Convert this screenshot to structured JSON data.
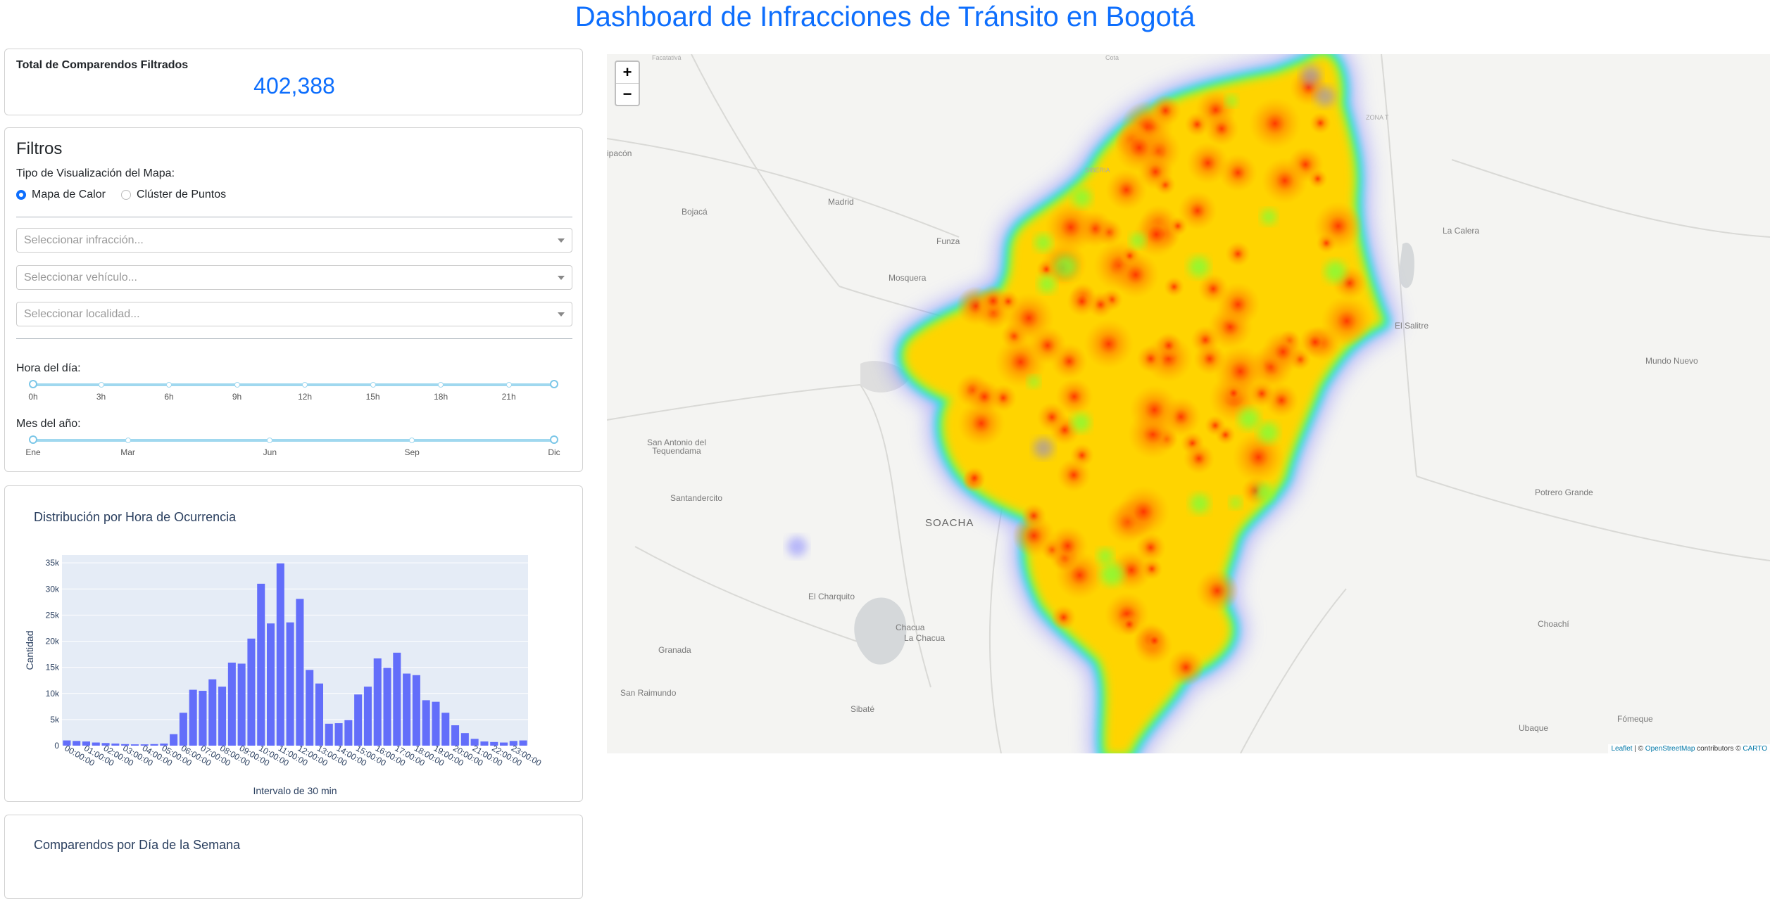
{
  "header": {
    "title": "Dashboard de Infracciones de Tránsito en Bogotá"
  },
  "total": {
    "label": "Total de Comparendos Filtrados",
    "value": "402,388"
  },
  "filters": {
    "title": "Filtros",
    "map_type_label": "Tipo de Visualización del Mapa:",
    "radio_options": [
      {
        "label": "Mapa de Calor",
        "checked": true
      },
      {
        "label": "Clúster de Puntos",
        "checked": false
      }
    ],
    "dropdowns": [
      {
        "placeholder": "Seleccionar infracción..."
      },
      {
        "placeholder": "Seleccionar vehículo..."
      },
      {
        "placeholder": "Seleccionar localidad..."
      }
    ],
    "hour_slider": {
      "label": "Hora del día:",
      "marks": [
        "0h",
        "3h",
        "6h",
        "9h",
        "12h",
        "15h",
        "18h",
        "21h"
      ],
      "min": 0,
      "max": 23,
      "range": [
        0,
        23
      ]
    },
    "month_slider": {
      "label": "Mes del año:",
      "marks": [
        "Ene",
        "Mar",
        "Jun",
        "Sep",
        "Dic"
      ],
      "min": 1,
      "max": 12,
      "range": [
        1,
        12
      ]
    }
  },
  "weekday_chart": {
    "title": "Comparendos por Día de la Semana"
  },
  "map": {
    "zoom_in": "+",
    "zoom_out": "−",
    "attribution": {
      "leaflet": "Leaflet",
      "sep": " | © ",
      "osm": "OpenStreetMap",
      "contrib": " contributors © ",
      "carto": "CARTO"
    },
    "places": [
      {
        "name": "Madrid",
        "class": ""
      },
      {
        "name": "Funza",
        "class": ""
      },
      {
        "name": "Mosquera",
        "class": ""
      },
      {
        "name": "Bojacá",
        "class": ""
      },
      {
        "name": "La Calera",
        "class": ""
      },
      {
        "name": "El Salitre",
        "class": ""
      },
      {
        "name": "Mundo Nuevo",
        "class": ""
      },
      {
        "name": "San Antonio del Tequendama",
        "class": ""
      },
      {
        "name": "Santandercito",
        "class": ""
      },
      {
        "name": "SOACHA",
        "class": "big"
      },
      {
        "name": "El Charquito",
        "class": ""
      },
      {
        "name": "Chacua",
        "class": ""
      },
      {
        "name": "La Chacua",
        "class": ""
      },
      {
        "name": "Granada",
        "class": ""
      },
      {
        "name": "San Raimundo",
        "class": ""
      },
      {
        "name": "Sibaté",
        "class": ""
      },
      {
        "name": "Potrero Grande",
        "class": ""
      },
      {
        "name": "Choachí",
        "class": ""
      },
      {
        "name": "Ubaque",
        "class": ""
      },
      {
        "name": "Fómeque",
        "class": ""
      },
      {
        "name": "ipacón",
        "class": ""
      },
      {
        "name": "SIBERIA",
        "class": "small"
      },
      {
        "name": "ZONA T",
        "class": "small"
      },
      {
        "name": "Facatativá",
        "class": "small"
      },
      {
        "name": "Cota",
        "class": "small"
      }
    ]
  },
  "colors": {
    "accent": "#0d6efd",
    "bar": "#636efa",
    "plot_bg": "#e5ecf6"
  },
  "chart_data": {
    "type": "bar",
    "title": "Distribución por Hora de Ocurrencia",
    "xlabel": "Intervalo de 30 min",
    "ylabel": "Cantidad",
    "ylim": [
      0,
      36500
    ],
    "ytick_values": [
      0,
      5000,
      10000,
      15000,
      20000,
      25000,
      30000,
      35000
    ],
    "ytick_labels": [
      "0",
      "5k",
      "10k",
      "15k",
      "20k",
      "25k",
      "30k",
      "35k"
    ],
    "xtick_labels": [
      "00:00:00",
      "01:00:00",
      "02:00:00",
      "03:00:00",
      "04:00:00",
      "05:00:00",
      "06:00:00",
      "07:00:00",
      "08:00:00",
      "09:00:00",
      "10:00:00",
      "11:00:00",
      "12:00:00",
      "13:00:00",
      "14:00:00",
      "15:00:00",
      "16:00:00",
      "17:00:00",
      "18:00:00",
      "19:00:00",
      "20:00:00",
      "21:00:00",
      "22:00:00",
      "23:00:00"
    ],
    "values": [
      1000,
      900,
      800,
      600,
      500,
      400,
      300,
      250,
      250,
      300,
      400,
      2200,
      6300,
      10700,
      10500,
      12700,
      11300,
      15900,
      15700,
      20500,
      31000,
      23400,
      34900,
      23600,
      28100,
      14500,
      11900,
      4200,
      4300,
      4900,
      9800,
      11300,
      16700,
      14900,
      17800,
      13800,
      13500,
      8700,
      8400,
      6300,
      3900,
      2400,
      1300,
      800,
      700,
      600,
      900,
      1000
    ]
  }
}
